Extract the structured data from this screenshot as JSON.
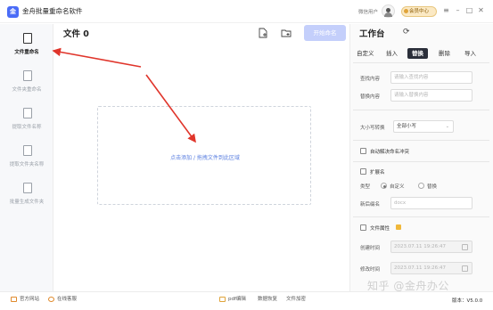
{
  "app": {
    "logo_glyph": "金",
    "title": "金舟批量重命名软件"
  },
  "titlebar": {
    "user_label": "微信用户",
    "vip_label": "会员中心",
    "controls": [
      "≡",
      "–",
      "□",
      "✕"
    ]
  },
  "sidebar": {
    "items": [
      {
        "label": "文件重命名",
        "icon": "file-rename-icon",
        "active": true
      },
      {
        "label": "文件夹重命名",
        "icon": "folder-rename-icon",
        "active": false
      },
      {
        "label": "提取文件名称",
        "icon": "extract-filename-icon",
        "active": false
      },
      {
        "label": "提取文件夹名称",
        "icon": "extract-foldername-icon",
        "active": false
      },
      {
        "label": "批量生成文件夹",
        "icon": "batch-folder-icon",
        "active": false
      }
    ]
  },
  "main": {
    "title": "文件 0",
    "start_label": "开始命名",
    "dropzone_text": "点击添加 / 拖拽文件到此区域"
  },
  "panel": {
    "title": "工作台",
    "tabs": [
      "自定义",
      "插入",
      "替换",
      "删除",
      "导入"
    ],
    "active_tab": "替换",
    "find_label": "查找内容",
    "find_placeholder": "请输入查找内容",
    "replace_label": "替换内容",
    "replace_placeholder": "请输入替换内容",
    "case_label": "大小写转换",
    "case_value": "全部小写",
    "auto_conflict_label": "自动解决命名冲突",
    "ext_label": "扩展名",
    "type_label": "类型",
    "type_options": [
      "自定义",
      "替换"
    ],
    "new_ext_label": "新后缀名",
    "new_ext_placeholder": "docx",
    "file_attr_label": "文件属性",
    "created_label": "创建时间",
    "created_value": "2023.07.11 19:26:47",
    "modified_label": "修改时间",
    "modified_value": "2023.07.11 19:26:47"
  },
  "bottombar": {
    "website": "官方网站",
    "support": "在线客服",
    "pdf_edit": "pdf编辑",
    "data_recovery": "数据恢复",
    "file_encrypt": "文件加密",
    "version": "版本：V5.0.0"
  },
  "watermark": "知乎 @金舟办公",
  "colors": {
    "accent": "#4a6cf7",
    "arrow": "#e0352b",
    "active_tab": "#2b2f3a"
  }
}
